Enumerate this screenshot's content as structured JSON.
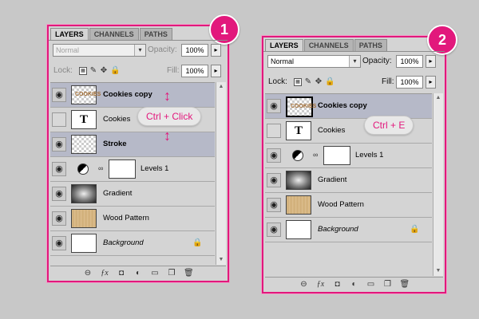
{
  "panel1": {
    "badge": "1",
    "tabs": [
      "LAYERS",
      "CHANNELS",
      "PATHS"
    ],
    "blend_mode": "Normal",
    "opacity_label": "Opacity:",
    "opacity_value": "100%",
    "lock_label": "Lock:",
    "fill_label": "Fill:",
    "fill_value": "100%",
    "layers": [
      {
        "name": "Cookies copy",
        "thumb": "checker"
      },
      {
        "name": "Cookies",
        "thumb": "text"
      },
      {
        "name": "Stroke",
        "thumb": "checker"
      },
      {
        "name": "Levels 1",
        "thumb": "adjustment"
      },
      {
        "name": "Gradient",
        "thumb": "gradient"
      },
      {
        "name": "Wood Pattern",
        "thumb": "wood"
      },
      {
        "name": "Background",
        "thumb": "white"
      }
    ],
    "callout": "Ctrl + Click"
  },
  "panel2": {
    "badge": "2",
    "tabs": [
      "LAYERS",
      "CHANNELS",
      "PATHS"
    ],
    "blend_mode": "Normal",
    "opacity_label": "Opacity:",
    "opacity_value": "100%",
    "lock_label": "Lock:",
    "fill_label": "Fill:",
    "fill_value": "100%",
    "layers": [
      {
        "name": "Cookies copy",
        "thumb": "checker"
      },
      {
        "name": "Cookies",
        "thumb": "text"
      },
      {
        "name": "Levels 1",
        "thumb": "adjustment"
      },
      {
        "name": "Gradient",
        "thumb": "gradient"
      },
      {
        "name": "Wood Pattern",
        "thumb": "wood"
      },
      {
        "name": "Background",
        "thumb": "white"
      }
    ],
    "callout": "Ctrl + E"
  },
  "text_thumb_glyph": "T",
  "accent_color": "#e2187c",
  "icons": [
    "eye-icon",
    "lock-icon",
    "chain-icon",
    "adjustment-icon",
    "link-layers-icon",
    "fx-icon",
    "mask-icon",
    "new-fill-icon",
    "folder-icon",
    "new-layer-icon",
    "trash-icon"
  ]
}
